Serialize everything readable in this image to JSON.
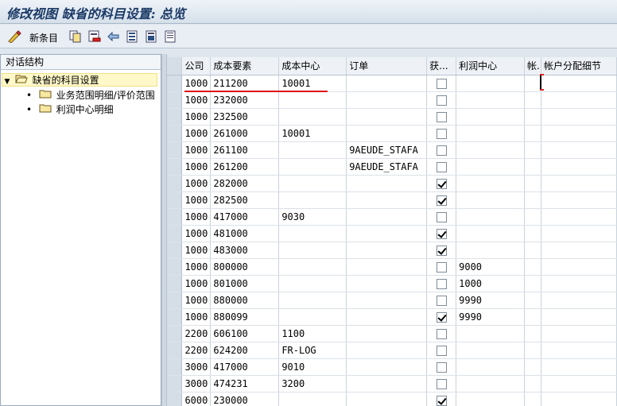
{
  "window": {
    "title": "修改视图 缺省的科目设置: 总览"
  },
  "toolbar": {
    "new_entries_label": "新条目",
    "icons": [
      "edit-glasses-icon",
      "copy-icon",
      "delete-icon",
      "undo-icon",
      "select-all-icon",
      "select-block-icon",
      "deselect-all-icon"
    ]
  },
  "dialog_structure": {
    "header": "对话结构",
    "root": "缺省的科目设置",
    "children": [
      "业务范围明细/评价范围",
      "利润中心明细"
    ]
  },
  "table": {
    "columns": [
      "公司",
      "成本要素",
      "成本中心",
      "订单",
      "获...",
      "利润中心",
      "帐.",
      "帐户分配细节"
    ],
    "rows": [
      {
        "company": "1000",
        "cost_element": "211200",
        "cost_center": "10001",
        "order": "",
        "checked": false,
        "profit_center": "",
        "acct": "",
        "detail": ""
      },
      {
        "company": "1000",
        "cost_element": "232000",
        "cost_center": "",
        "order": "",
        "checked": false,
        "profit_center": "",
        "acct": "",
        "detail": ""
      },
      {
        "company": "1000",
        "cost_element": "232500",
        "cost_center": "",
        "order": "",
        "checked": false,
        "profit_center": "",
        "acct": "",
        "detail": ""
      },
      {
        "company": "1000",
        "cost_element": "261000",
        "cost_center": "10001",
        "order": "",
        "checked": false,
        "profit_center": "",
        "acct": "",
        "detail": ""
      },
      {
        "company": "1000",
        "cost_element": "261100",
        "cost_center": "",
        "order": "9AEUDE_STAFA",
        "checked": false,
        "profit_center": "",
        "acct": "",
        "detail": ""
      },
      {
        "company": "1000",
        "cost_element": "261200",
        "cost_center": "",
        "order": "9AEUDE_STAFA",
        "checked": false,
        "profit_center": "",
        "acct": "",
        "detail": ""
      },
      {
        "company": "1000",
        "cost_element": "282000",
        "cost_center": "",
        "order": "",
        "checked": true,
        "profit_center": "",
        "acct": "",
        "detail": ""
      },
      {
        "company": "1000",
        "cost_element": "282500",
        "cost_center": "",
        "order": "",
        "checked": true,
        "profit_center": "",
        "acct": "",
        "detail": ""
      },
      {
        "company": "1000",
        "cost_element": "417000",
        "cost_center": "9030",
        "order": "",
        "checked": false,
        "profit_center": "",
        "acct": "",
        "detail": ""
      },
      {
        "company": "1000",
        "cost_element": "481000",
        "cost_center": "",
        "order": "",
        "checked": true,
        "profit_center": "",
        "acct": "",
        "detail": ""
      },
      {
        "company": "1000",
        "cost_element": "483000",
        "cost_center": "",
        "order": "",
        "checked": true,
        "profit_center": "",
        "acct": "",
        "detail": ""
      },
      {
        "company": "1000",
        "cost_element": "800000",
        "cost_center": "",
        "order": "",
        "checked": false,
        "profit_center": "9000",
        "acct": "",
        "detail": ""
      },
      {
        "company": "1000",
        "cost_element": "801000",
        "cost_center": "",
        "order": "",
        "checked": false,
        "profit_center": "1000",
        "acct": "",
        "detail": ""
      },
      {
        "company": "1000",
        "cost_element": "880000",
        "cost_center": "",
        "order": "",
        "checked": false,
        "profit_center": "9990",
        "acct": "",
        "detail": ""
      },
      {
        "company": "1000",
        "cost_element": "880099",
        "cost_center": "",
        "order": "",
        "checked": true,
        "profit_center": "9990",
        "acct": "",
        "detail": ""
      },
      {
        "company": "2200",
        "cost_element": "606100",
        "cost_center": "1100",
        "order": "",
        "checked": false,
        "profit_center": "",
        "acct": "",
        "detail": ""
      },
      {
        "company": "2200",
        "cost_element": "624200",
        "cost_center": "FR-LOG",
        "order": "",
        "checked": false,
        "profit_center": "",
        "acct": "",
        "detail": ""
      },
      {
        "company": "3000",
        "cost_element": "417000",
        "cost_center": "9010",
        "order": "",
        "checked": false,
        "profit_center": "",
        "acct": "",
        "detail": ""
      },
      {
        "company": "3000",
        "cost_element": "474231",
        "cost_center": "3200",
        "order": "",
        "checked": false,
        "profit_center": "",
        "acct": "",
        "detail": ""
      },
      {
        "company": "6000",
        "cost_element": "230000",
        "cost_center": "",
        "order": "",
        "checked": true,
        "profit_center": "",
        "acct": "",
        "detail": ""
      }
    ]
  },
  "colors": {
    "title_text": "#1b3a66",
    "highlight_underline": "#e01010",
    "tree_selected_bg": "#fff8c8"
  }
}
